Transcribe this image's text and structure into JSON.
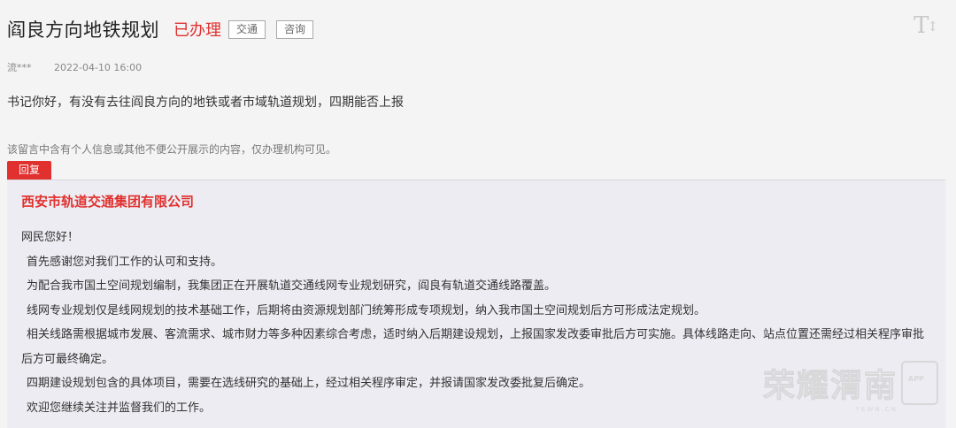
{
  "header": {
    "title": "阎良方向地铁规划",
    "status": "已办理",
    "tags": [
      "交通",
      "咨询"
    ],
    "font_toggle": "T",
    "font_toggle_arrow": "↕"
  },
  "meta": {
    "user": "流***",
    "time": "2022-04-10 16:00"
  },
  "question": "书记你好，有没有去往阎良方向的地铁或者市域轨道规划，四期能否上报",
  "privacy_note": "该留言中含有个人信息或其他不便公开展示的内容，仅办理机构可见。",
  "reply": {
    "tab_label": "回复",
    "org": "西安市轨道交通集团有限公司",
    "paragraphs": [
      "网民您好！",
      "首先感谢您对我们工作的认可和支持。",
      "为配合我市国土空间规划编制，我集团正在开展轨道交通线网专业规划研究，阎良有轨道交通线路覆盖。",
      "线网专业规划仅是线网规划的技术基础工作，后期将由资源规划部门统筹形成专项规划，纳入我市国土空间规划后方可形成法定规划。",
      "相关线路需根据城市发展、客流需求、城市财力等多种因素综合考虑，适时纳入后期建设规划，上报国家发改委审批后方可实施。具体线路走向、站点位置还需经过相关程序审批后方可最终确定。",
      "四期建设规划包含的具体项目，需要在选线研究的基础上，经过相关程序审定，并报请国家发改委批复后确定。",
      "欢迎您继续关注并监督我们的工作。"
    ]
  },
  "watermark": {
    "text": "荣耀渭南",
    "app": "APP",
    "url": "YEWN.CN"
  },
  "colors": {
    "accent": "#e0312f",
    "reply_bg": "#ececf2",
    "page_bg": "#f4f4f4"
  }
}
